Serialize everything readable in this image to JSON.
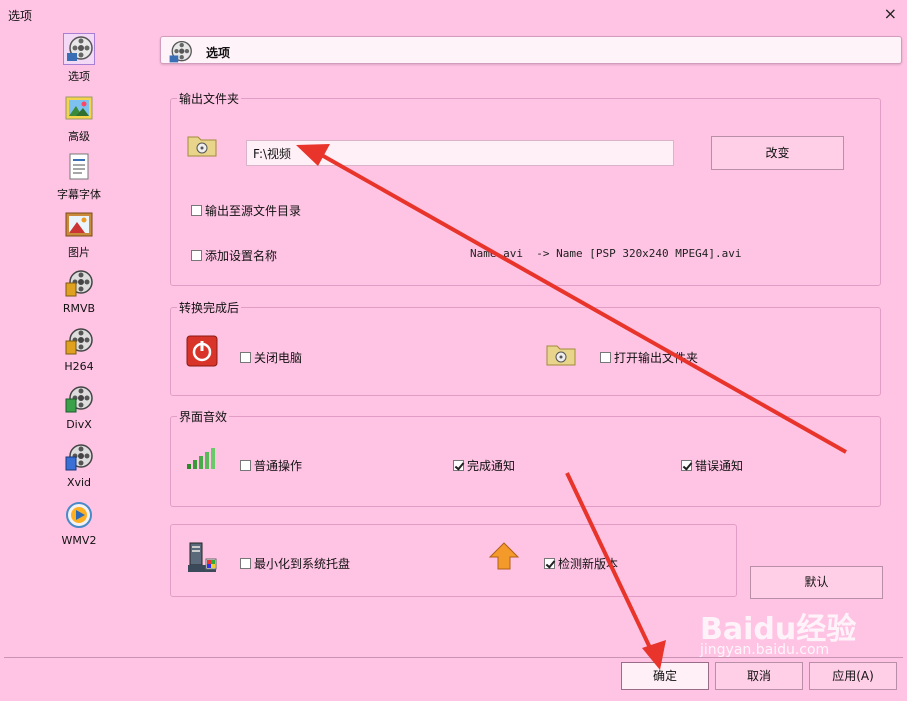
{
  "window": {
    "title": "选项",
    "close_glyph": "×"
  },
  "sidebar": {
    "items": [
      {
        "label": "选项",
        "icon": "film-reel-icon"
      },
      {
        "label": "高级",
        "icon": "picture-icon"
      },
      {
        "label": "字幕字体",
        "icon": "document-icon"
      },
      {
        "label": "图片",
        "icon": "image-icon"
      },
      {
        "label": "RMVB",
        "icon": "film-reel-icon"
      },
      {
        "label": "H264",
        "icon": "film-reel-icon"
      },
      {
        "label": "DivX",
        "icon": "film-reel-icon"
      },
      {
        "label": "Xvid",
        "icon": "film-reel-icon"
      },
      {
        "label": "WMV2",
        "icon": "media-play-icon"
      }
    ]
  },
  "header": {
    "title": "选项"
  },
  "output_folder": {
    "group_title": "输出文件夹",
    "path_value": "F:\\视频",
    "change_button": "改变",
    "output_to_source_label": "输出至源文件目录",
    "add_setting_name_label": "添加设置名称",
    "sample_text": "Name.avi  -> Name [PSP 320x240 MPEG4].avi"
  },
  "after_convert": {
    "group_title": "转换完成后",
    "shutdown_label": "关闭电脑",
    "open_folder_label": "打开输出文件夹"
  },
  "sound": {
    "group_title": "界面音效",
    "normal_label": "普通操作",
    "normal_checked": false,
    "done_label": "完成通知",
    "done_checked": true,
    "error_label": "错误通知",
    "error_checked": true
  },
  "misc": {
    "minimize_tray_label": "最小化到系统托盘",
    "minimize_tray_checked": false,
    "check_update_label": "检测新版本",
    "check_update_checked": true
  },
  "buttons": {
    "default": "默认",
    "ok": "确定",
    "cancel": "取消",
    "apply": "应用(A)"
  },
  "watermark": {
    "brand": "Baidu经验",
    "url": "jingyan.baidu.com"
  },
  "colors": {
    "background": "#ffc4e4",
    "annotation_arrow": "#e8342a"
  }
}
